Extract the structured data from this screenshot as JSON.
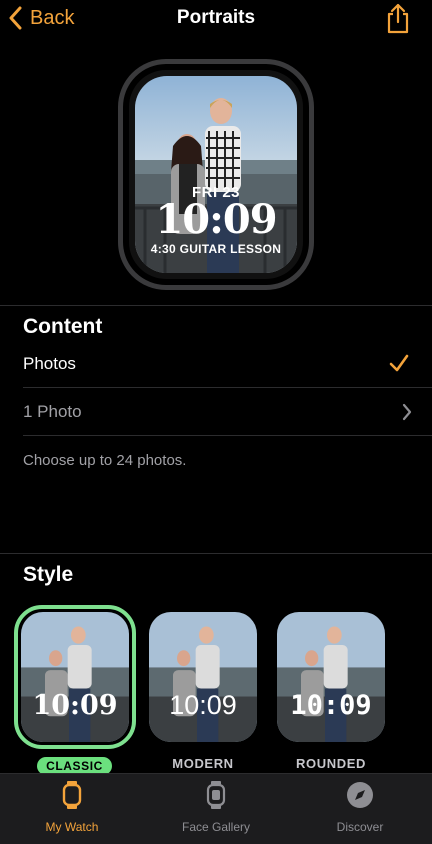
{
  "nav": {
    "back_label": "Back",
    "title": "Portraits"
  },
  "preview": {
    "day": "FRI 23",
    "time": "10:09",
    "event": "4:30 GUITAR LESSON"
  },
  "content": {
    "title": "Content",
    "photos_label": "Photos",
    "photo_count_label": "1 Photo",
    "hint": "Choose up to 24 photos."
  },
  "style": {
    "title": "Style",
    "options": [
      {
        "label": "CLASSIC",
        "time": "10:09",
        "selected": true
      },
      {
        "label": "MODERN",
        "time": "10:09",
        "selected": false
      },
      {
        "label": "ROUNDED",
        "time": "10:09",
        "selected": false
      }
    ]
  },
  "tabs": [
    {
      "label": "My Watch",
      "icon": "watch-icon",
      "active": true
    },
    {
      "label": "Face Gallery",
      "icon": "face-gallery-icon",
      "active": false
    },
    {
      "label": "Discover",
      "icon": "compass-icon",
      "active": false
    }
  ],
  "colors": {
    "accent": "#f3a33b",
    "selected": "#6be07e",
    "background": "#000000",
    "tabbar": "#1c1c1e"
  }
}
